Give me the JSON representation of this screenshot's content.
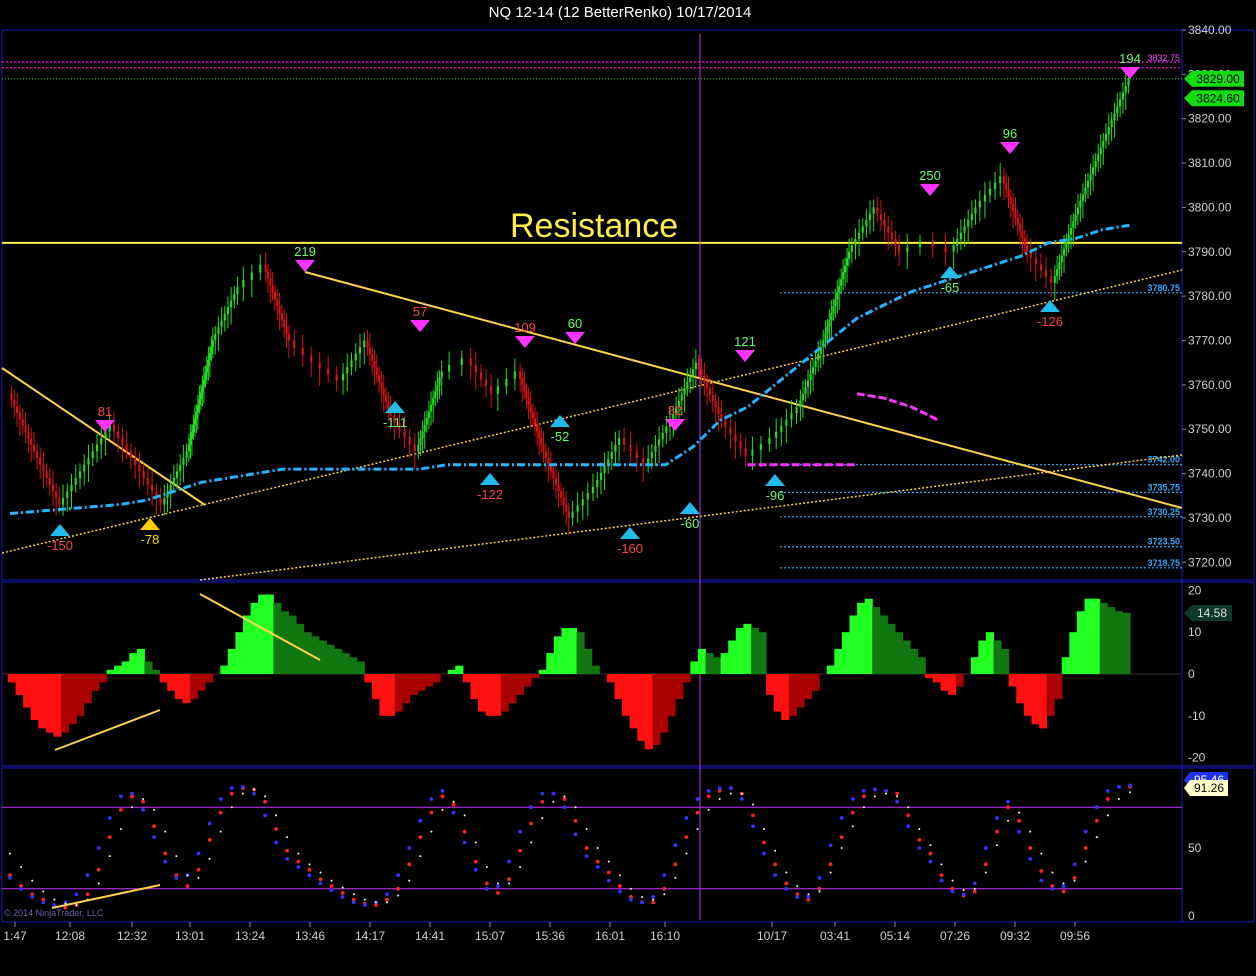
{
  "chart_title": "NQ 12-14 (12 BetterRenko)  10/17/2014",
  "copyright": "© 2014 NinjaTrader, LLC",
  "chart_data": {
    "type": "line",
    "price_panel": {
      "ylim": [
        3716,
        3840
      ],
      "y_ticks": [
        "3840.00",
        "3830.00",
        "3820.00",
        "3810.00",
        "3800.00",
        "3790.00",
        "3780.00",
        "3770.00",
        "3760.00",
        "3750.00",
        "3740.00",
        "3730.00",
        "3720.00"
      ],
      "price_labels": [
        {
          "value": 3829.0,
          "text": "3829.00"
        },
        {
          "value": 3824.6,
          "text": "3824.60"
        }
      ],
      "level_lines": [
        {
          "value": 3832.75,
          "text": "3832.75",
          "color": "#ff00ff"
        },
        {
          "value": 3831.5,
          "text": "3831.50",
          "color": "#ff00ff"
        },
        {
          "value": 3780.75,
          "text": "3780.75",
          "color": "#33aaff"
        },
        {
          "value": 3742.0,
          "text": "3742.00",
          "color": "#33aaff"
        },
        {
          "value": 3735.75,
          "text": "3735.75",
          "color": "#33aaff"
        },
        {
          "value": 3730.25,
          "text": "3730.25",
          "color": "#33aaff"
        },
        {
          "value": 3723.5,
          "text": "3723.50",
          "color": "#33aaff"
        },
        {
          "value": 3718.75,
          "text": "3718.75",
          "color": "#33aaff"
        }
      ],
      "resistance_label": "Resistance",
      "resistance_value": 3792.0,
      "swing_labels": [
        {
          "text": "81",
          "type": "high",
          "color": "#ff4444"
        },
        {
          "text": "-150",
          "type": "low",
          "color": "#ff4444"
        },
        {
          "text": "-78",
          "type": "low",
          "color": "#ffd700"
        },
        {
          "text": "219",
          "type": "high",
          "color": "#66ff66"
        },
        {
          "text": "-111",
          "type": "low",
          "color": "#66ff66"
        },
        {
          "text": "57",
          "type": "high",
          "color": "#ff4444"
        },
        {
          "text": "-122",
          "type": "low",
          "color": "#ff4444"
        },
        {
          "text": "109",
          "type": "high",
          "color": "#ff4444"
        },
        {
          "text": "-52",
          "type": "low",
          "color": "#66ff66"
        },
        {
          "text": "60",
          "type": "high",
          "color": "#66ff66"
        },
        {
          "text": "-160",
          "type": "low",
          "color": "#ff4444"
        },
        {
          "text": "82",
          "type": "high",
          "color": "#ff4444"
        },
        {
          "text": "-60",
          "type": "low",
          "color": "#66ff66"
        },
        {
          "text": "121",
          "type": "high",
          "color": "#66ff66"
        },
        {
          "text": "-96",
          "type": "low",
          "color": "#66ff66"
        },
        {
          "text": "250",
          "type": "high",
          "color": "#66ff66"
        },
        {
          "text": "-65",
          "type": "low",
          "color": "#66ff66"
        },
        {
          "text": "96",
          "type": "high",
          "color": "#66ff66"
        },
        {
          "text": "-126",
          "type": "low",
          "color": "#ff4444"
        },
        {
          "text": "194",
          "type": "high",
          "color": "#66ff66"
        }
      ],
      "price_path": [
        3758,
        3745,
        3733,
        3742,
        3751,
        3742,
        3733,
        3745,
        3770,
        3782,
        3787,
        3770,
        3765,
        3761,
        3770,
        3753,
        3745,
        3763,
        3766,
        3758,
        3763,
        3745,
        3730,
        3737,
        3748,
        3742,
        3752,
        3765,
        3752,
        3744,
        3748,
        3755,
        3770,
        3790,
        3800,
        3790,
        3792,
        3790,
        3800,
        3807,
        3790,
        3783,
        3800,
        3815,
        3829
      ],
      "ma_path": [
        3731,
        3731.5,
        3732,
        3732.5,
        3733,
        3734,
        3736,
        3738,
        3739,
        3740,
        3741,
        3741,
        3741,
        3741,
        3741,
        3741,
        3742,
        3742,
        3742,
        3742,
        3742,
        3742,
        3742,
        3742,
        3742,
        3746,
        3752,
        3755,
        3760,
        3765,
        3770,
        3775,
        3778,
        3781,
        3783,
        3785,
        3787,
        3789,
        3792,
        3793,
        3795,
        3796
      ],
      "magenta_segments": [
        {
          "from": 27,
          "to": 31,
          "values": [
            3742,
            3742,
            3742,
            3742,
            3742
          ]
        },
        {
          "from": 31,
          "to": 34,
          "values": [
            3758,
            3757,
            3755,
            3752
          ]
        }
      ]
    },
    "macd_panel": {
      "ylim": [
        -22,
        22
      ],
      "y_ticks": [
        "20",
        "10",
        "0",
        "-10",
        "-20"
      ],
      "last_value": "14.58",
      "values": [
        -2,
        -5,
        -8,
        -11,
        -13,
        -14,
        -15,
        -14,
        -12,
        -10,
        -7,
        -4,
        -2,
        1,
        2,
        3,
        5,
        6,
        3,
        1,
        -2,
        -4,
        -6,
        -7,
        -6,
        -4,
        -2,
        0,
        2,
        6,
        10,
        14,
        17,
        19,
        19,
        17,
        15,
        14,
        12,
        10,
        9,
        8,
        7,
        6,
        5,
        4,
        3,
        -2,
        -6,
        -10,
        -10,
        -9,
        -7,
        -5,
        -4,
        -3,
        -2,
        0,
        1,
        2,
        -2,
        -6,
        -9,
        -10,
        -10,
        -9,
        -7,
        -5,
        -3,
        -1,
        1,
        5,
        9,
        11,
        11,
        10,
        6,
        2,
        0,
        -2,
        -6,
        -10,
        -13,
        -16,
        -18,
        -17,
        -14,
        -10,
        -6,
        -2,
        3,
        6,
        5,
        4,
        5,
        8,
        11,
        12,
        11,
        10,
        -5,
        -9,
        -11,
        -10,
        -8,
        -6,
        -4,
        0,
        2,
        6,
        10,
        14,
        17,
        18,
        16,
        14,
        12,
        10,
        8,
        6,
        4,
        -1,
        -2,
        -4,
        -5,
        -3,
        0,
        4,
        8,
        10,
        8,
        6,
        -3,
        -7,
        -10,
        -12,
        -13,
        -10,
        -6,
        4,
        10,
        15,
        18,
        18,
        17,
        16,
        15,
        14.6
      ]
    },
    "stoch_panel": {
      "ylim": [
        0,
        100
      ],
      "y_ticks": [
        "50",
        "0"
      ],
      "last_values": [
        "95.46",
        "91.26"
      ],
      "upper_level": 80,
      "lower_level": 20,
      "series": [
        {
          "color": "#ff2222",
          "values": [
            30,
            22,
            16,
            12,
            8,
            6,
            8,
            16,
            34,
            58,
            78,
            88,
            84,
            66,
            46,
            30,
            22,
            34,
            56,
            76,
            90,
            94,
            93,
            84,
            64,
            48,
            40,
            34,
            27,
            22,
            17,
            12,
            9,
            8,
            12,
            20,
            38,
            58,
            76,
            88,
            82,
            62,
            40,
            24,
            17,
            27,
            48,
            68,
            84,
            90,
            86,
            70,
            50,
            40,
            32,
            22,
            14,
            10,
            10,
            20,
            38,
            58,
            76,
            88,
            92,
            94,
            90,
            74,
            54,
            38,
            24,
            16,
            12,
            20,
            38,
            58,
            76,
            88,
            93,
            92,
            90,
            74,
            56,
            46,
            30,
            20,
            15,
            18,
            38,
            62,
            80,
            70,
            50,
            33,
            22,
            18,
            28,
            50,
            70,
            86,
            95,
            95
          ]
        },
        {
          "color": "#3333ff",
          "values": [
            28,
            20,
            14,
            10,
            8,
            10,
            16,
            30,
            50,
            72,
            88,
            90,
            78,
            58,
            40,
            28,
            30,
            46,
            68,
            86,
            94,
            95,
            90,
            74,
            54,
            42,
            36,
            30,
            24,
            19,
            14,
            10,
            8,
            10,
            16,
            30,
            50,
            70,
            86,
            92,
            76,
            54,
            34,
            20,
            22,
            40,
            62,
            80,
            90,
            90,
            80,
            60,
            44,
            36,
            26,
            18,
            12,
            10,
            14,
            30,
            52,
            72,
            86,
            92,
            94,
            94,
            86,
            66,
            46,
            30,
            20,
            14,
            14,
            28,
            52,
            72,
            86,
            92,
            93,
            92,
            84,
            66,
            50,
            40,
            26,
            18,
            16,
            24,
            50,
            72,
            84,
            62,
            42,
            26,
            20,
            22,
            38,
            62,
            80,
            92,
            95,
            96
          ]
        },
        {
          "color": "#ffffe0",
          "values": [
            46,
            36,
            26,
            18,
            12,
            9,
            8,
            12,
            24,
            44,
            64,
            80,
            86,
            78,
            62,
            44,
            30,
            28,
            42,
            62,
            80,
            90,
            93,
            88,
            74,
            58,
            46,
            38,
            32,
            26,
            21,
            16,
            12,
            10,
            10,
            15,
            26,
            44,
            62,
            78,
            84,
            74,
            54,
            36,
            24,
            24,
            36,
            54,
            72,
            84,
            88,
            80,
            64,
            50,
            40,
            30,
            20,
            14,
            12,
            16,
            28,
            46,
            64,
            78,
            86,
            90,
            90,
            82,
            64,
            48,
            32,
            22,
            16,
            18,
            32,
            50,
            66,
            80,
            88,
            90,
            88,
            80,
            64,
            52,
            38,
            26,
            19,
            20,
            32,
            52,
            70,
            76,
            62,
            46,
            32,
            24,
            26,
            40,
            58,
            74,
            86,
            91
          ]
        }
      ]
    },
    "x_ticks": [
      "1:47",
      "12:08",
      "12:32",
      "13:01",
      "13:24",
      "13:46",
      "14:17",
      "14:41",
      "15:07",
      "15:36",
      "16:01",
      "16:10",
      "10/17",
      "03:41",
      "05:14",
      "07:26",
      "09:32",
      "09:56"
    ]
  },
  "colors": {
    "background": "#000000",
    "panel_border": "#1a1acc",
    "up_bar": "#22dd22",
    "down_bar": "#dd1111",
    "resistance": "#ffee44",
    "trend_line": "#ffd24a",
    "ma_line": "#22b4ff",
    "marker_high": "#ff33ff",
    "marker_low": "#22bbee"
  }
}
